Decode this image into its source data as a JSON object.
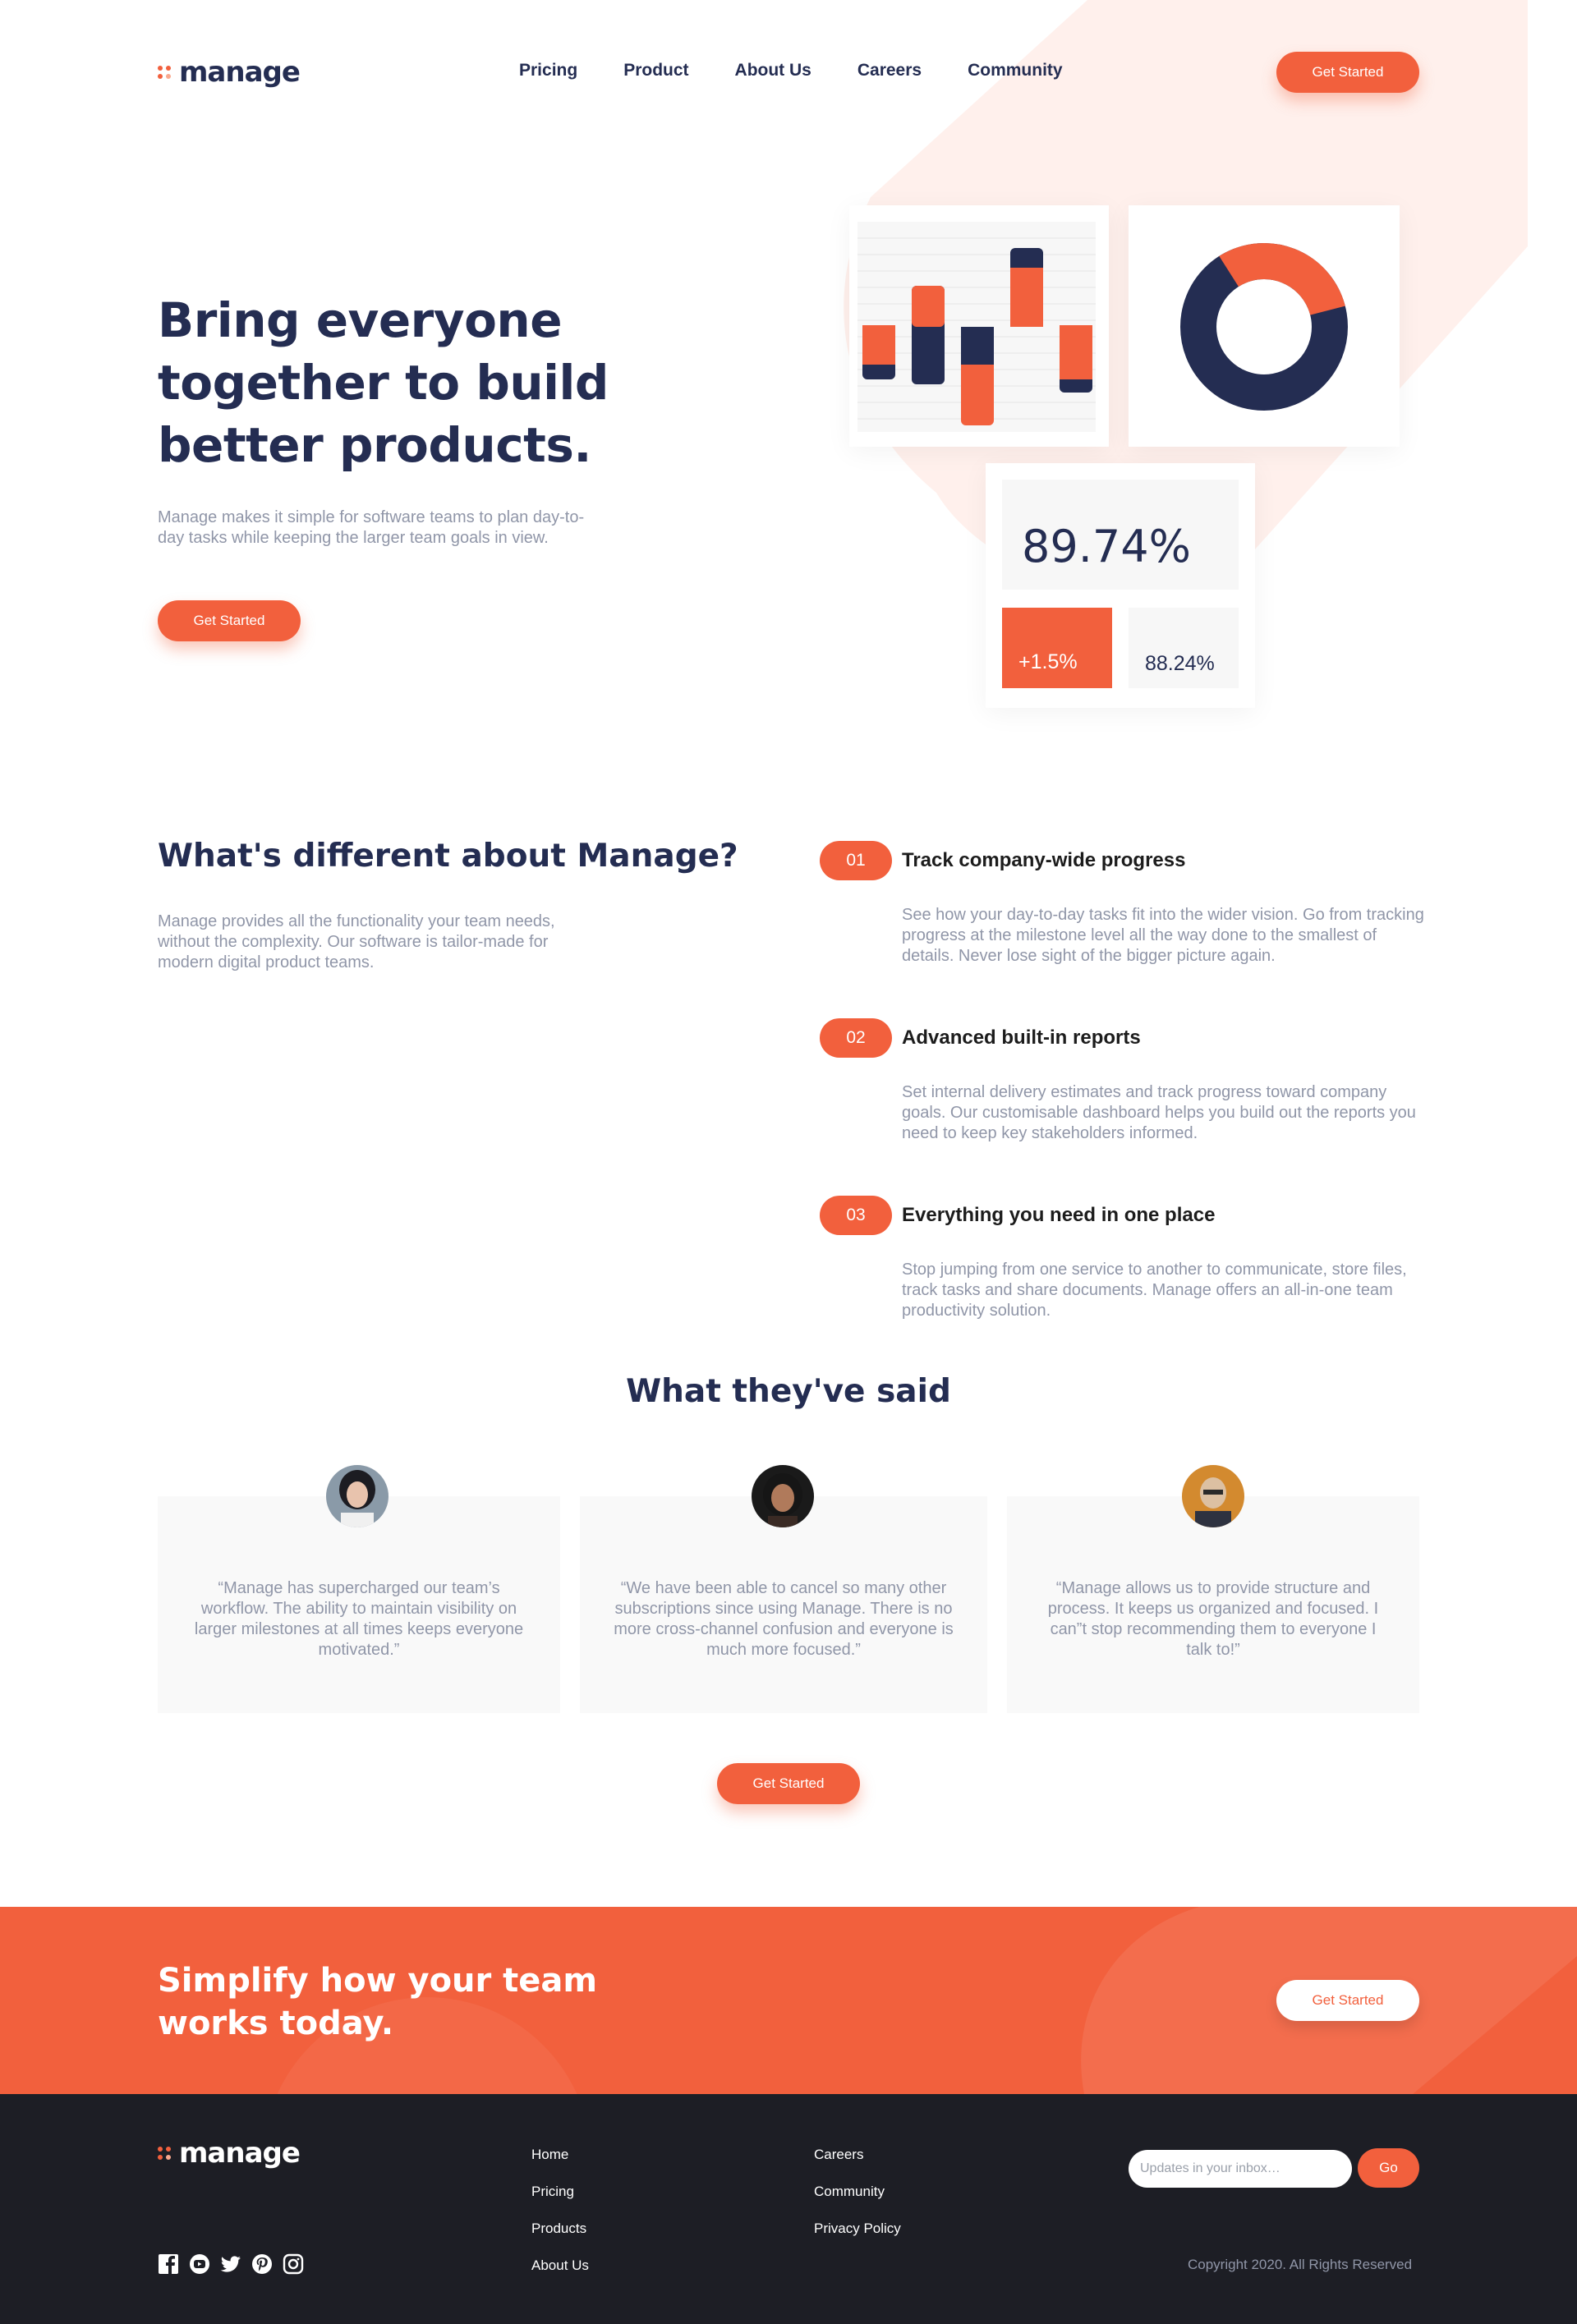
{
  "brand": {
    "name": "manage",
    "accent": "#f2603d",
    "navy": "#242d52",
    "footer_bg": "#1d1e25"
  },
  "nav": {
    "items": [
      "Pricing",
      "Product",
      "About Us",
      "Careers",
      "Community"
    ],
    "cta": "Get Started"
  },
  "hero": {
    "title": "Bring everyone together to build better products.",
    "description": "Manage makes it simple for software teams to plan day-to-day tasks while keeping the larger team goals in view.",
    "cta": "Get Started",
    "dashboard": {
      "big_stat": "89.74%",
      "change_stat": "+1.5%",
      "secondary_stat": "88.24%",
      "donut_share": 0.3
    }
  },
  "features": {
    "title": "What's different about Manage?",
    "description": "Manage provides all the functionality your team needs, without the complexity. Our software is tailor-made for modern digital product teams.",
    "items": [
      {
        "number": "01",
        "title": "Track company-wide progress",
        "description": "See how your day-to-day tasks fit into the wider vision. Go from tracking progress at the milestone level all the way done to the smallest of details. Never lose sight of the bigger picture again."
      },
      {
        "number": "02",
        "title": "Advanced built-in reports",
        "description": "Set internal delivery estimates and track progress toward company goals. Our customisable dashboard helps you build out the reports you need to keep key stakeholders informed."
      },
      {
        "number": "03",
        "title": "Everything you need in one place",
        "description": "Stop jumping from one service to another to communicate, store files, track tasks and share documents. Manage offers an all-in-one team productivity solution."
      }
    ]
  },
  "testimonials": {
    "title": "What they've said",
    "items": [
      {
        "quote": "“Manage has supercharged our team’s workflow. The ability to maintain visibility on larger milestones at all times keeps everyone motivated.”",
        "avatar": "avatar-woman-1"
      },
      {
        "quote": "“We have been able to cancel so many other subscriptions since using Manage. There is no more cross-channel confusion and everyone is much more focused.”",
        "avatar": "avatar-woman-2"
      },
      {
        "quote": "“Manage allows us to provide structure and process. It keeps us organized and focused. I can”t stop recommending them to everyone I talk to!”",
        "avatar": "avatar-man-1"
      }
    ],
    "cta": "Get Started"
  },
  "cta_banner": {
    "title": "Simplify how your team works today.",
    "cta": "Get Started"
  },
  "footer": {
    "links_col1": [
      "Home",
      "Pricing",
      "Products",
      "About Us"
    ],
    "links_col2": [
      "Careers",
      "Community",
      "Privacy Policy"
    ],
    "subscribe_placeholder": "Updates in your inbox…",
    "subscribe_button": "Go",
    "copyright": "Copyright 2020. All Rights Reserved",
    "social_icons": [
      "facebook-icon",
      "youtube-icon",
      "twitter-icon",
      "pinterest-icon",
      "instagram-icon"
    ]
  }
}
